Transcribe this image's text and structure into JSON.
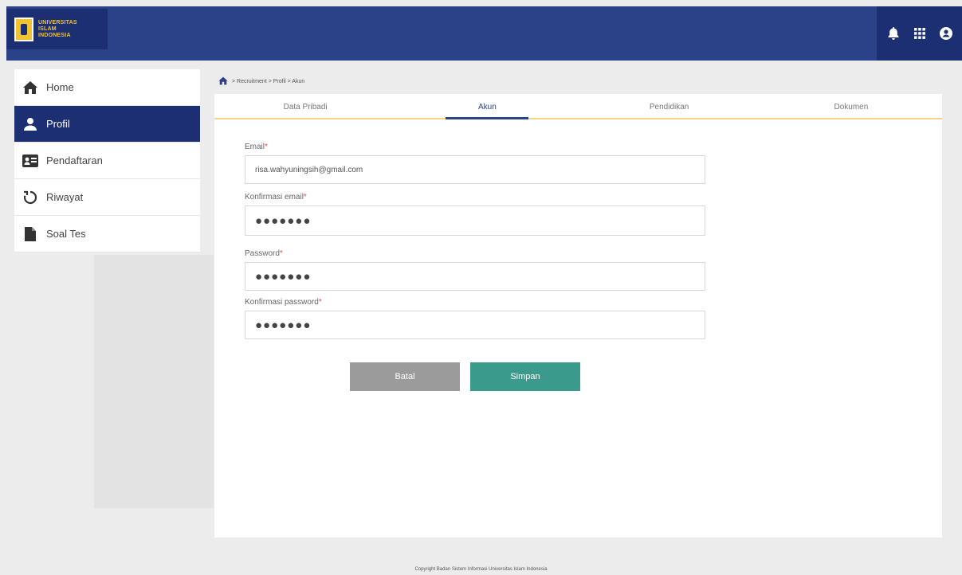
{
  "brand": {
    "line1": "UNIVERSITAS",
    "line2": "ISLAM",
    "line3": "INDONESIA"
  },
  "header": {
    "icons": [
      "bell-icon",
      "apps-grid-icon",
      "account-icon"
    ]
  },
  "sidebar": {
    "items": [
      {
        "label": "Home",
        "icon": "home-icon",
        "active": false
      },
      {
        "label": "Profil",
        "icon": "user-icon",
        "active": true
      },
      {
        "label": "Pendaftaran",
        "icon": "id-card-icon",
        "active": false
      },
      {
        "label": "Riwayat",
        "icon": "history-icon",
        "active": false
      },
      {
        "label": "Soal Tes",
        "icon": "document-icon",
        "active": false
      }
    ]
  },
  "breadcrumb": {
    "text": "> Recruitment > Profil > Akun"
  },
  "tabs": [
    {
      "label": "Data Pribadi"
    },
    {
      "label": "Akun"
    },
    {
      "label": "Pendidikan"
    },
    {
      "label": "Dokumen"
    }
  ],
  "form": {
    "email": {
      "label": "Email",
      "value": "risa.wahyuningsih@gmail.com"
    },
    "confirm_email": {
      "label": "Konfirmasi email",
      "value": "●●●●●●●"
    },
    "password": {
      "label": "Password",
      "value": "●●●●●●●"
    },
    "confirm_password": {
      "label": "Konfirmasi password",
      "value": "●●●●●●●"
    },
    "required_mark": "*"
  },
  "buttons": {
    "back": "Batal",
    "save": "Simpan"
  },
  "footer": {
    "text": "Copyright Badan Sistem Informasi Universitas Islam Indonesia"
  },
  "colors": {
    "primary": "#2c4288",
    "dark": "#1d2f73",
    "save": "#3a9a8c",
    "back": "#9b9b9b",
    "accent": "#f2d488"
  }
}
